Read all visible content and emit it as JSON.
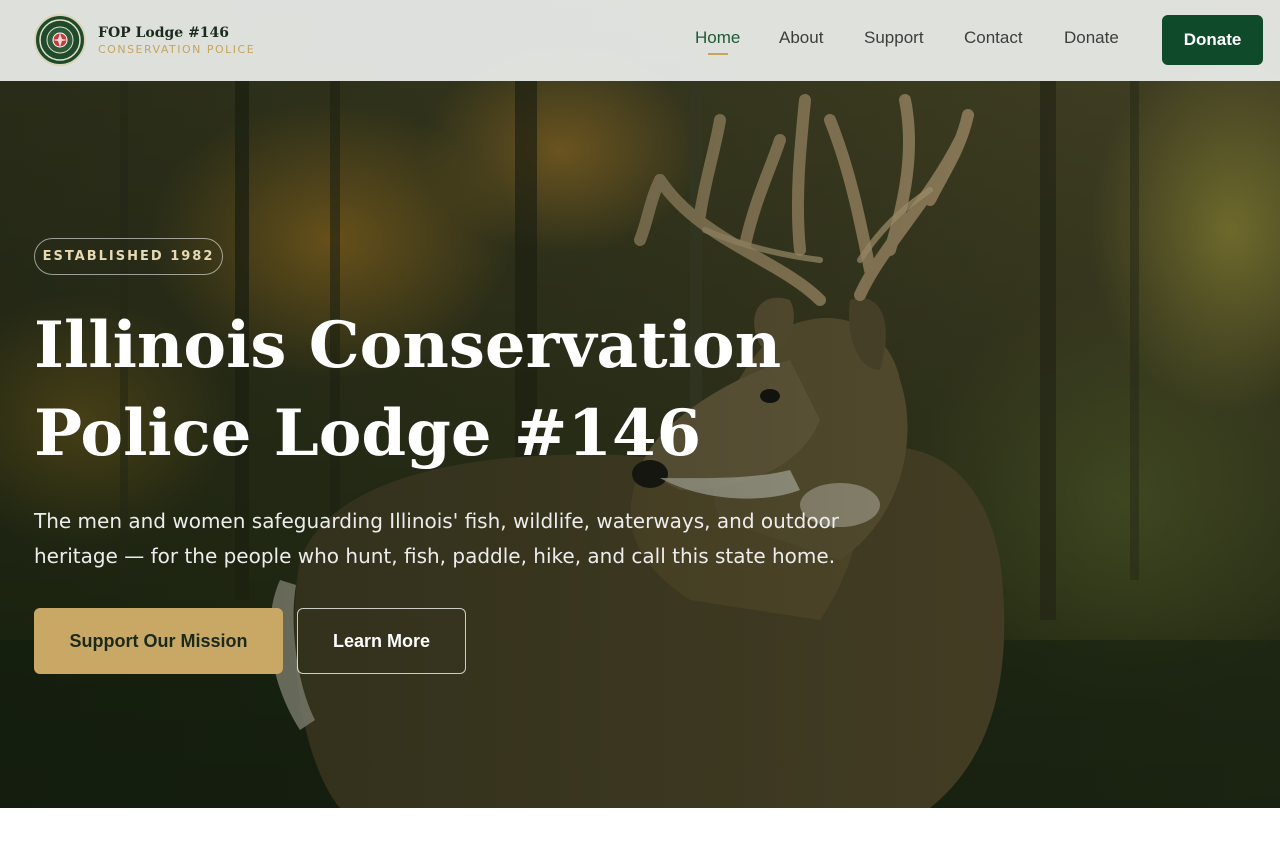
{
  "header": {
    "brand_name": "FOP Lodge #146",
    "brand_subtitle": "CONSERVATION POLICE",
    "nav": [
      {
        "label": "Home",
        "active": true
      },
      {
        "label": "About",
        "active": false
      },
      {
        "label": "Support",
        "active": false
      },
      {
        "label": "Contact",
        "active": false
      },
      {
        "label": "Donate",
        "active": false
      }
    ],
    "donate_button": "Donate"
  },
  "hero": {
    "badge": "ESTABLISHED 1982",
    "title_line1": "Illinois Conservation",
    "title_line2": "Police Lodge #146",
    "description": "The men and women safeguarding Illinois' fish, wildlife, waterways, and outdoor heritage — for the people who hunt, fish, paddle, hike, and call this state home.",
    "primary_button": "Support Our Mission",
    "secondary_button": "Learn More",
    "background_image": "white-tailed deer buck in autumn forest"
  },
  "colors": {
    "brand_green": "#0f4a2b",
    "accent_gold": "#c9a764",
    "active_nav": "#1f5a36"
  }
}
